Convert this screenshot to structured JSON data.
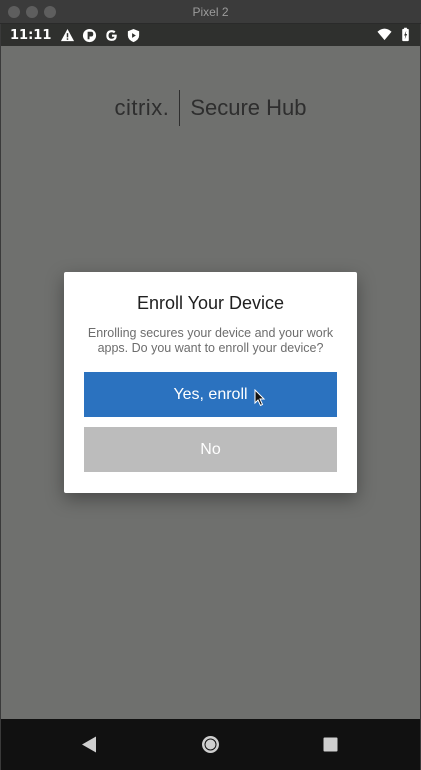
{
  "window": {
    "title": "Pixel 2"
  },
  "status_bar": {
    "time": "11:11",
    "left_icons": [
      "warning-icon",
      "app-icon",
      "google-icon",
      "shield-icon"
    ],
    "right_icons": [
      "wifi-icon",
      "battery-icon"
    ]
  },
  "app": {
    "logo_brand": "citrix.",
    "logo_product": "Secure Hub"
  },
  "dialog": {
    "title": "Enroll Your Device",
    "message": "Enrolling secures your device and your work apps. Do you want to enroll your device?",
    "yes_label": "Yes, enroll",
    "no_label": "No"
  },
  "colors": {
    "primary_button": "#2b72bf",
    "secondary_button": "#bcbcbc",
    "scrim": "#6f706e"
  },
  "nav_bar": {
    "buttons": [
      "back-icon",
      "home-icon",
      "recents-icon"
    ]
  }
}
